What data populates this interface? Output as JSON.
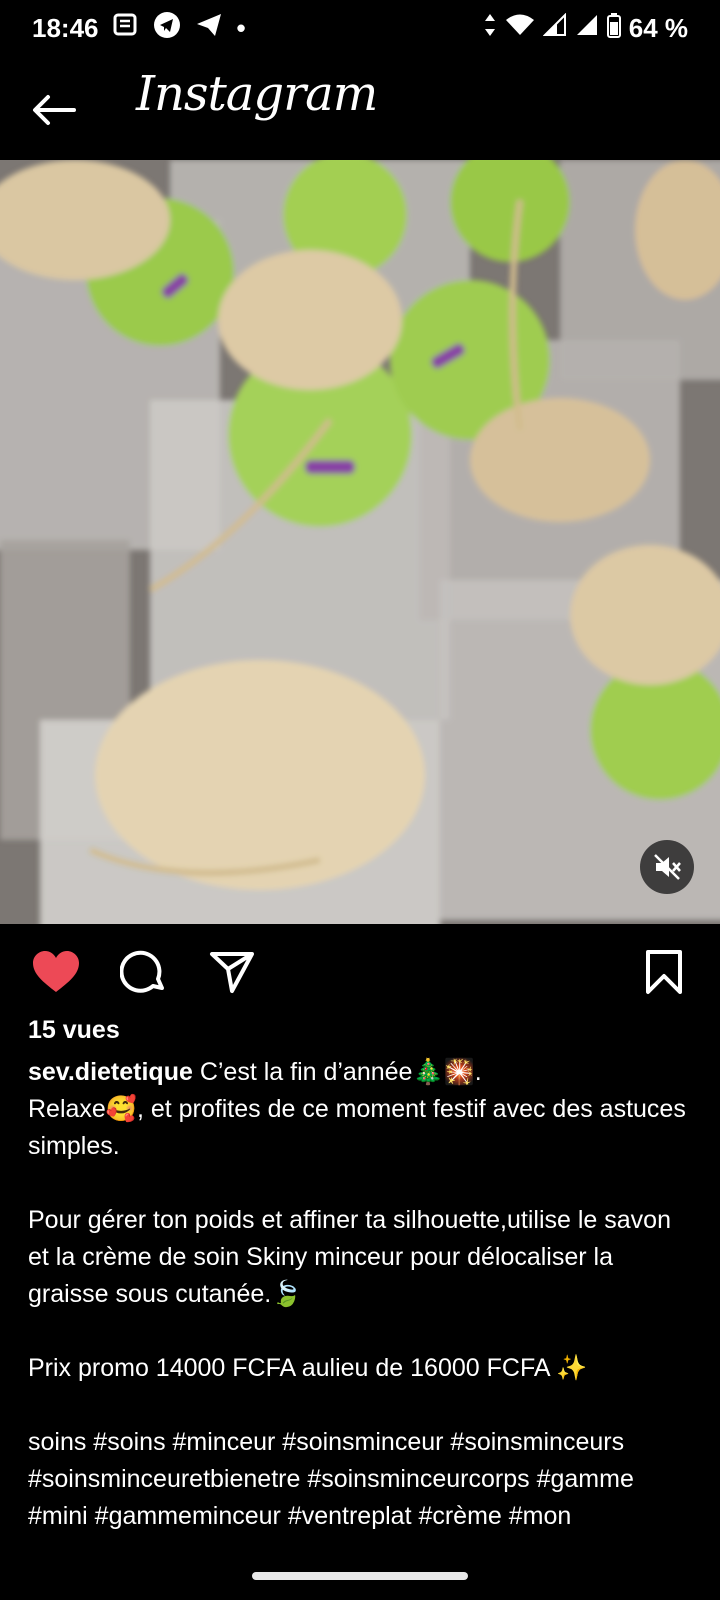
{
  "status_bar": {
    "time": "18:46",
    "dot": "•",
    "battery": "64 %",
    "left_icons": [
      "news-icon",
      "telegram-icon",
      "send-icon"
    ],
    "right_icons": [
      "data-arrows-icon",
      "wifi-icon",
      "signal-icon",
      "signal-icon",
      "battery-icon"
    ]
  },
  "header": {
    "title": "Instagram",
    "back_icon": "arrow-left-icon"
  },
  "media": {
    "description_icon": "muted-speaker-icon"
  },
  "actions": {
    "like_icon": "heart-filled-icon",
    "like_color": "#ed4956",
    "comment_icon": "comment-icon",
    "share_icon": "send-icon",
    "save_icon": "bookmark-icon"
  },
  "post": {
    "views": "15 vues",
    "username": "sev.dietetique",
    "caption": " C’est la fin d’année🎄🎇.\nRelaxe🥰, et profites de ce moment festif avec des astuces simples.\n\nPour gérer ton poids et affiner ta silhouette,utilise le savon et la crème de soin Skiny minceur pour délocaliser la graisse sous cutanée.🍃\n\nPrix promo 14000 FCFA aulieu de 16000 FCFA ✨\n\nsoins #soins #minceur #soinsminceur #soinsminceurs #soinsminceuretbienetre #soinsminceurcorps #gamme #mini #gammeminceur #ventreplat #crème #mon"
  }
}
